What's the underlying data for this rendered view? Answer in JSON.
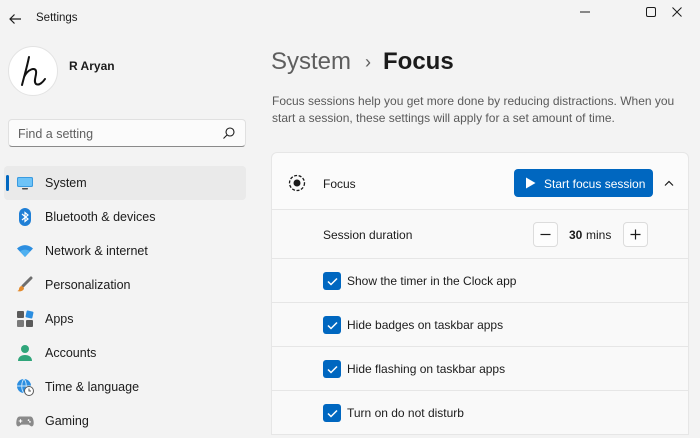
{
  "window": {
    "title": "Settings"
  },
  "profile": {
    "name": "R Aryan"
  },
  "search": {
    "placeholder": "Find a setting"
  },
  "sidebar": {
    "items": [
      {
        "label": "System",
        "icon": "monitor-icon",
        "active": true
      },
      {
        "label": "Bluetooth & devices",
        "icon": "bluetooth-icon"
      },
      {
        "label": "Network & internet",
        "icon": "wifi-icon"
      },
      {
        "label": "Personalization",
        "icon": "brush-icon"
      },
      {
        "label": "Apps",
        "icon": "apps-icon"
      },
      {
        "label": "Accounts",
        "icon": "person-icon"
      },
      {
        "label": "Time & language",
        "icon": "globe-clock-icon"
      },
      {
        "label": "Gaming",
        "icon": "gamepad-icon"
      }
    ]
  },
  "breadcrumb": {
    "parent": "System",
    "separator": "›",
    "current": "Focus"
  },
  "description": "Focus sessions help you get more done by reducing distractions. When you start a session, these settings will apply for a set amount of time.",
  "focus": {
    "label": "Focus",
    "start_button_label": "Start focus session",
    "expanded": true
  },
  "session_duration": {
    "label": "Session duration",
    "value": "30",
    "unit": "mins"
  },
  "options": [
    {
      "label": "Show the timer in the Clock app",
      "checked": true
    },
    {
      "label": "Hide badges on taskbar apps",
      "checked": true
    },
    {
      "label": "Hide flashing on taskbar apps",
      "checked": true
    },
    {
      "label": "Turn on do not disturb",
      "checked": true
    }
  ],
  "colors": {
    "accent": "#0067c0",
    "background": "#f3f3f3",
    "card": "#fbfbfb"
  }
}
